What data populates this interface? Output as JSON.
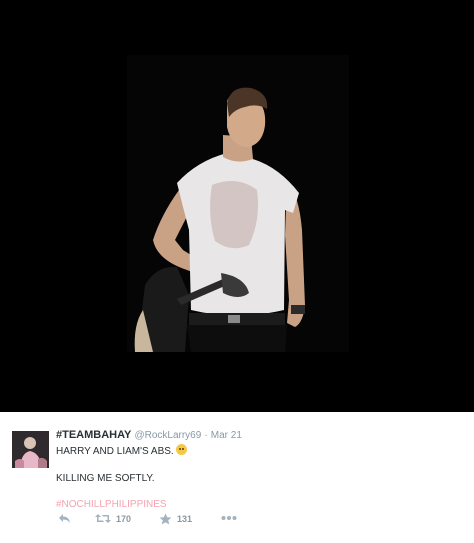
{
  "tweet": {
    "display_name": "#TEAMBAHAY",
    "handle": "@RockLarry69",
    "separator": "·",
    "timestamp": "Mar 21",
    "line1": "HARRY AND LIAM'S ABS.",
    "line1_emoji": "crying-face-icon",
    "line2": "KILLING ME SOFTLY.",
    "hashtag": "#NOCHILLPHILIPPINES",
    "hashtag_color": "#f5a3b0"
  },
  "actions": {
    "reply_icon": "reply-icon",
    "retweet_icon": "retweet-icon",
    "retweet_count": "170",
    "favorite_icon": "star-icon",
    "favorite_count": "131",
    "more_icon": "more-icon"
  },
  "colors": {
    "media_background": "#000000",
    "name_text": "#292f33",
    "meta_text": "#8899a6",
    "action_icons": "#a5b3be"
  }
}
